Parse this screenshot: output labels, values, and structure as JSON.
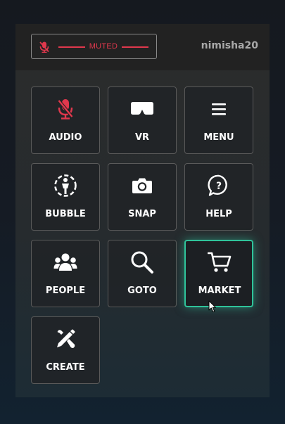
{
  "header": {
    "mute_label": "MUTED",
    "username": "nimisha20"
  },
  "tiles": [
    {
      "label": "AUDIO",
      "icon": "mic-muted-icon",
      "color": "#e0384d"
    },
    {
      "label": "VR",
      "icon": "vr-headset-icon"
    },
    {
      "label": "MENU",
      "icon": "hamburger-menu-icon"
    },
    {
      "label": "BUBBLE",
      "icon": "bubble-icon"
    },
    {
      "label": "SNAP",
      "icon": "camera-icon"
    },
    {
      "label": "HELP",
      "icon": "help-question-icon"
    },
    {
      "label": "PEOPLE",
      "icon": "people-icon"
    },
    {
      "label": "GOTO",
      "icon": "search-icon"
    },
    {
      "label": "MARKET",
      "icon": "cart-icon",
      "state": "hovered",
      "accent": "#2fc39a"
    },
    {
      "label": "CREATE",
      "icon": "create-tools-icon"
    }
  ],
  "colors": {
    "muted_red": "#e0384d",
    "hover_accent": "#2fc39a",
    "tile_border": "#5a5a5a"
  }
}
